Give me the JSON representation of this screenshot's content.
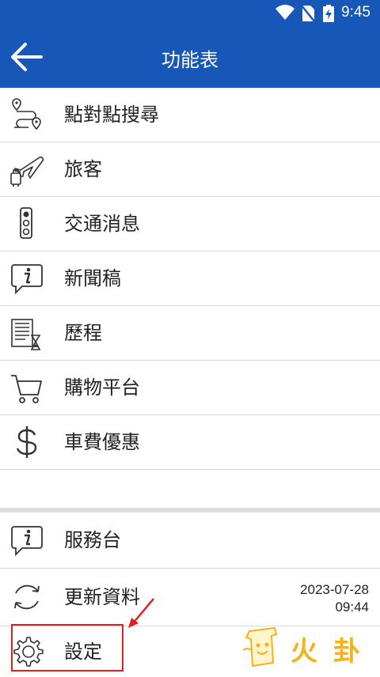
{
  "status_bar": {
    "time": "9:45"
  },
  "toolbar": {
    "title": "功能表"
  },
  "menu": {
    "items": [
      {
        "label": "點對點搜尋",
        "icon": "route-icon"
      },
      {
        "label": "旅客",
        "icon": "traveler-plane-icon"
      },
      {
        "label": "交通消息",
        "icon": "traffic-light-icon"
      },
      {
        "label": "新聞稿",
        "icon": "info-bubble-icon"
      },
      {
        "label": "歷程",
        "icon": "history-list-icon"
      },
      {
        "label": "購物平台",
        "icon": "shopping-cart-icon"
      },
      {
        "label": "車費優惠",
        "icon": "dollar-icon"
      }
    ],
    "service_desk": {
      "label": "服務台",
      "icon": "info-bubble-icon"
    },
    "update": {
      "label": "更新資料",
      "icon": "refresh-icon",
      "date": "2023-07-28",
      "time": "09:44"
    },
    "settings": {
      "label": "設定",
      "icon": "gear-icon"
    }
  },
  "watermark": {
    "text": "火 卦"
  },
  "colors": {
    "appbar": "#1757b8",
    "highlight": "#e02020",
    "watermark": "#f3b319"
  }
}
